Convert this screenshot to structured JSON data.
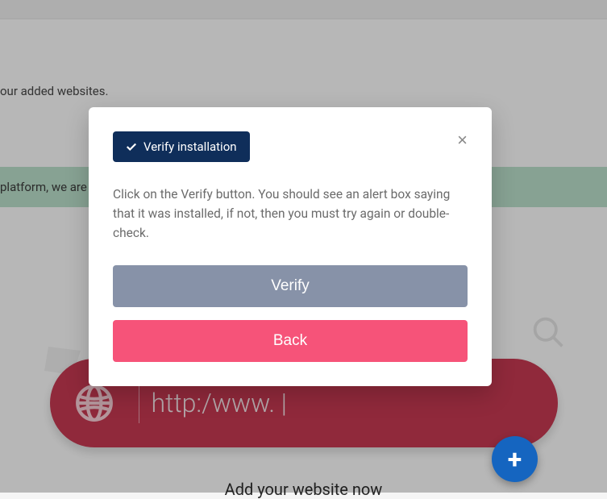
{
  "background": {
    "added_websites_text": "our added websites.",
    "banner_text": "platform, we are",
    "url_placeholder": "http:/www. |",
    "add_website_text": "Add your website now"
  },
  "modal": {
    "badge_label": "Verify installation",
    "description": "Click on the Verify button. You should see an alert box saying that it was installed, if not, then you must try again or double-check.",
    "verify_label": "Verify",
    "back_label": "Back"
  },
  "fab": {
    "plus": "+"
  }
}
